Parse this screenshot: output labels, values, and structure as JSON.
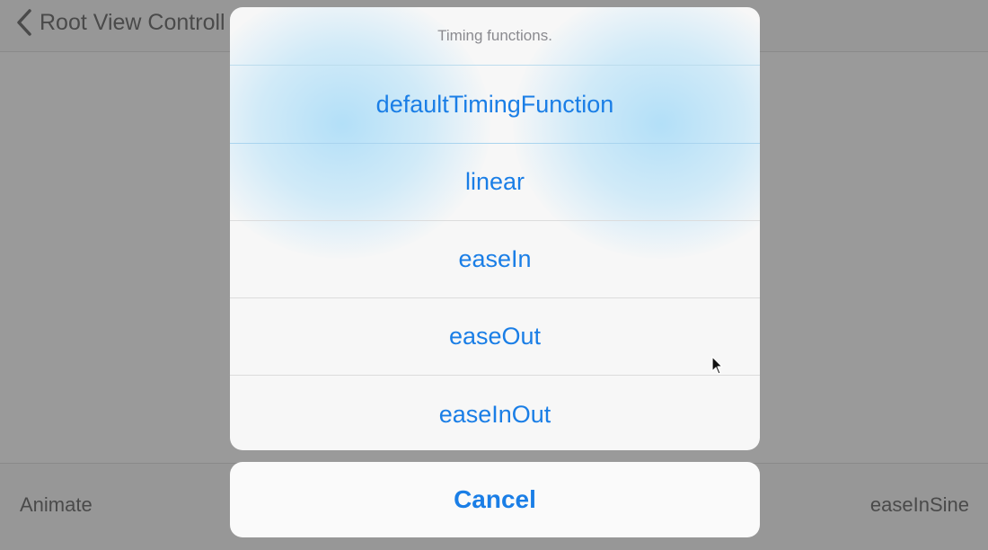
{
  "nav": {
    "back_label": "Root View Controll"
  },
  "toolbar": {
    "left_label": "Animate",
    "right_label": "easeInSine"
  },
  "action_sheet": {
    "title": "Timing functions.",
    "actions": [
      {
        "label": "defaultTimingFunction"
      },
      {
        "label": "linear"
      },
      {
        "label": "easeIn"
      },
      {
        "label": "easeOut"
      },
      {
        "label": "easeInOut"
      }
    ],
    "cancel_label": "Cancel"
  },
  "colors": {
    "accent": "#1a7ee6",
    "dim_background": "#9a9a9a",
    "sheet_background": "#f7f7f7",
    "title_text": "#8a8a8f"
  },
  "icons": {
    "back": "chevron-left-icon",
    "cursor": "mouse-pointer-icon"
  }
}
